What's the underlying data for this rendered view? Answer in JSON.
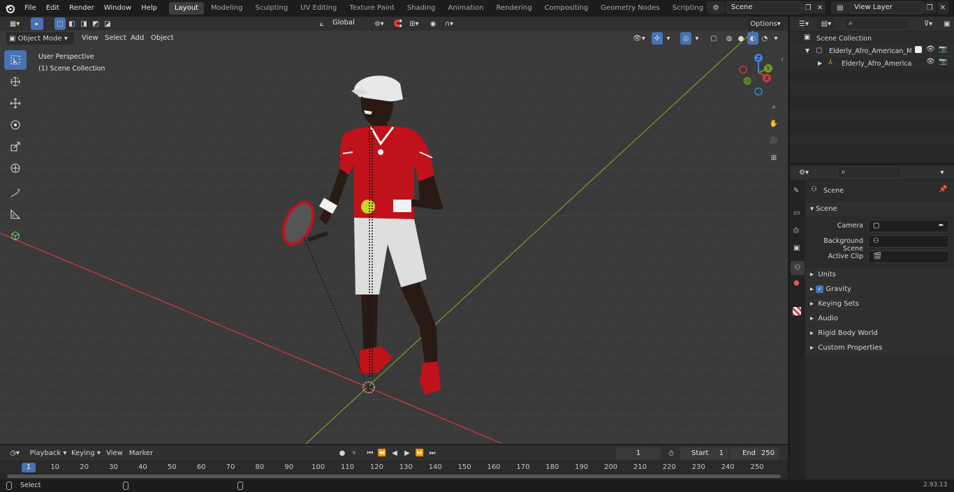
{
  "menu": [
    "File",
    "Edit",
    "Render",
    "Window",
    "Help"
  ],
  "workspaces": [
    "Layout",
    "Modeling",
    "Sculpting",
    "UV Editing",
    "Texture Paint",
    "Shading",
    "Animation",
    "Rendering",
    "Compositing",
    "Geometry Nodes",
    "Scripting"
  ],
  "scene_field": "Scene",
  "view_layer_field": "View Layer",
  "header": {
    "transform_orientation": "Global",
    "options": "Options",
    "mode": "Object Mode",
    "view": "View",
    "select": "Select",
    "add": "Add",
    "object": "Object"
  },
  "viewport": {
    "perspective": "User Perspective",
    "collection": "(1) Scene Collection"
  },
  "gizmo": {
    "x": "X",
    "y": "Y",
    "z": "Z"
  },
  "outliner": {
    "root": "Scene Collection",
    "item1": "Elderly_Afro_American_Man_I",
    "item2": "Elderly_Afro_American_M"
  },
  "properties": {
    "tab_title": "Scene",
    "panel_title": "Scene",
    "camera_label": "Camera",
    "background_label": "Background Scene",
    "clip_label": "Active Clip",
    "sections": [
      "Units",
      "Gravity",
      "Keying Sets",
      "Audio",
      "Rigid Body World",
      "Custom Properties"
    ]
  },
  "timeline": {
    "playback": "Playback",
    "keying": "Keying",
    "view": "View",
    "marker": "Marker",
    "current_frame": "1",
    "start_label": "Start",
    "start_value": "1",
    "end_label": "End",
    "end_value": "250",
    "ticks": [
      "1",
      "10",
      "20",
      "30",
      "40",
      "50",
      "60",
      "70",
      "80",
      "90",
      "100",
      "110",
      "120",
      "130",
      "140",
      "150",
      "160",
      "170",
      "180",
      "190",
      "200",
      "210",
      "220",
      "230",
      "240",
      "250"
    ]
  },
  "status": {
    "select": "Select",
    "version": "2.93.13"
  },
  "colors": {
    "accent": "#4772b3",
    "shirt": "#c0121b",
    "x_axis": "#c93c3c",
    "y_axis": "#6f9b2a"
  }
}
